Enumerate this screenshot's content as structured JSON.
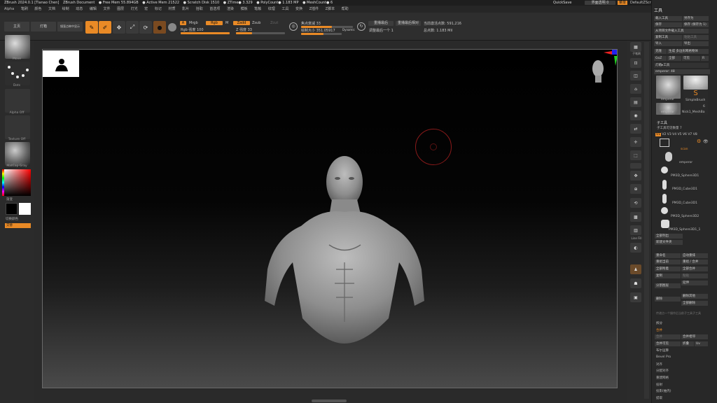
{
  "titlebar": [
    "ZBrush 2024.0.1 [Tianao Chen]",
    "ZBrush Document",
    "● Free Mem 55.894GB",
    "● Active Mem 21522",
    "● Scratch Disk 1510",
    "● ZTime● 3.329",
    "● PolyCount● 1.183 MP",
    "● MeshCount● 6"
  ],
  "top_right": {
    "quicksave": "QuickSave",
    "transparency": "界面透明 0",
    "menu": "菜单",
    "script": "DefaultZScript"
  },
  "menus": [
    "Alpha",
    "笔刷",
    "颜色",
    "文档",
    "绘制",
    "动态",
    "编辑",
    "文件",
    "图层",
    "灯光",
    "宏",
    "标记",
    "材质",
    "影片",
    "拾取",
    "首选项",
    "渲染",
    "模板",
    "笔触",
    "纹理",
    "工具",
    "变换",
    "Z插件",
    "Z脚本",
    "帮助"
  ],
  "toolbar": {
    "light_box": "主页",
    "spotlight": "灯箱",
    "history": "镜笼点映中显示",
    "edit": "Edit",
    "draw": "Draw",
    "move": "Move",
    "scale": "Scale",
    "rotate": "Rotate",
    "a": "A",
    "mrgb": "Mrgb",
    "rgb": "Rgb",
    "m": "M",
    "zadd": "Zadd",
    "zsub": "Zsub",
    "zcut": "Zcut",
    "rgb_intensity": "Rgb 强度 100",
    "z_intensity": "Z 强度 33",
    "focal_shift": "焦点衰减 33",
    "draw_size": "绘制大小 351.05917",
    "dynamic": "Dynamic",
    "active_points": "当前激活点数: 591,216",
    "total_points": "总点数: 1.183 Mil",
    "replay_last": "重播最后",
    "replay_rel": "重播最后相对",
    "adjust_last": "调整最后一个 1"
  },
  "progress": {
    "rgb_intensity": 1.0,
    "z_intensity": 0.33,
    "focal_shift": 0.6,
    "draw_size": 0.55
  },
  "left_tray": {
    "brush": "Move",
    "stroke": "Dots",
    "alpha": "Alpha Off",
    "texture": "Texture Off",
    "material": "MatCap Gray",
    "gradient": "渐变",
    "switch_color": "切换颜色",
    "alternate": "交替"
  },
  "right_icons": [
    "子笔刷",
    "",
    "透视",
    "地板",
    "局部",
    "",
    "",
    "框架",
    "移动",
    "缩放",
    "旋转",
    "",
    "线框",
    "",
    "",
    "",
    "",
    "",
    "Line Fill",
    "",
    "",
    "",
    ""
  ],
  "panel": {
    "title": "工具",
    "buttons_top": [
      [
        "载入工具",
        "另存为"
      ],
      [
        "保存",
        "保存 (保存为 1)"
      ],
      [
        "从项目文件载入工具",
        ""
      ],
      [
        "复制工具",
        "粘贴工具"
      ],
      [
        "导入",
        "导出"
      ],
      [
        "克隆",
        "生成 多边形网格物体"
      ],
      [
        "GoZ",
        "全部",
        "可见",
        "R"
      ]
    ],
    "lightbox": "灯箱▸工具",
    "current_tool": "emperor: 48",
    "tool_thumbs": [
      "emperor",
      "Cylinder3D",
      "SimpleBrush",
      "emperor",
      "Nick1_MeshBa"
    ],
    "tool_counts": [
      "",
      "",
      "",
      "",
      "6"
    ],
    "subtool_header": "子工具",
    "subtool_count": "子工具可见数量 7",
    "view_tabs": [
      "V1",
      "V2",
      "V3",
      "V4",
      "V5",
      "V6",
      "V7",
      "V8"
    ],
    "subtools": [
      "emperor",
      "PM3D_Sphere3D1",
      "PM3D_Cube3D1",
      "PM3D_Cube3D1",
      "PM3D_Sphere3D2",
      "PM3D_Sphere3D1_1"
    ],
    "active_subtool_tag": "scan",
    "list_all": "全部列出",
    "auto_collapse": "新建文件夹",
    "actions": [
      [
        "重命名",
        "自动重排"
      ],
      [
        "重组当前",
        "重组 / 合并"
      ],
      [
        "全部附着",
        "全部合并"
      ],
      [
        "复制",
        "粘贴"
      ],
      [
        "分割图层",
        "延伸"
      ],
      [
        "删除",
        "删除其他"
      ],
      [
        "",
        "全部删除"
      ]
    ],
    "hint": "传递点一个操作后当前子工具子工具",
    "split": "拆分",
    "merge": "合并",
    "bool": [
      "合并",
      "合并相邻"
    ],
    "boolean_rows": [
      "合并可见",
      "折叠",
      "Uv"
    ],
    "extra": [
      "布尔运算",
      "Bevel Pro",
      "对齐",
      "分配对齐",
      "重建网格",
      "投射",
      "投影(抽壳)",
      "提取"
    ]
  }
}
